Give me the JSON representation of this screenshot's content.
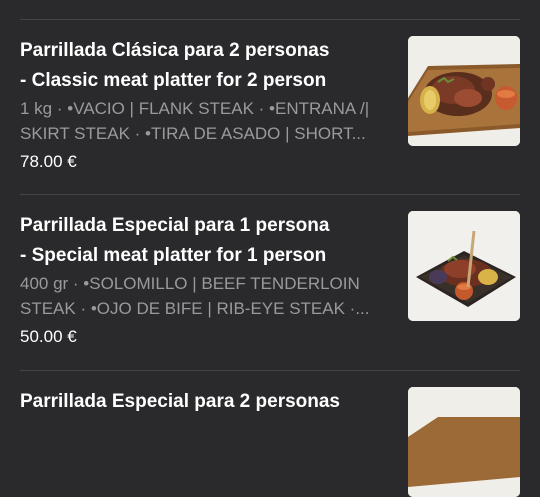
{
  "menu_items": [
    {
      "title_line1": "Parrillada Clásica para 2 personas",
      "title_line2": "- Classic meat platter for 2 person",
      "desc_line1": "1 kg · •VACIO | FLANK STEAK · •ENTRANA /|",
      "desc_line2": "SKIRT STEAK · •TIRA DE ASADO | SHORT...",
      "price": "78.00 €",
      "image_icon": "meat-platter-photo"
    },
    {
      "title_line1": "Parrillada Especial para 1 persona",
      "title_line2": "- Special meat platter for 1 person",
      "desc_line1": "400 gr · •SOLOMILLO | BEEF TENDERLOIN",
      "desc_line2": "STEAK · •OJO DE BIFE | RIB-EYE STEAK ·...",
      "price": "50.00 €",
      "image_icon": "meat-platter-photo"
    },
    {
      "title_line1": "Parrillada Especial para 2 personas",
      "image_icon": "meat-platter-photo"
    }
  ]
}
